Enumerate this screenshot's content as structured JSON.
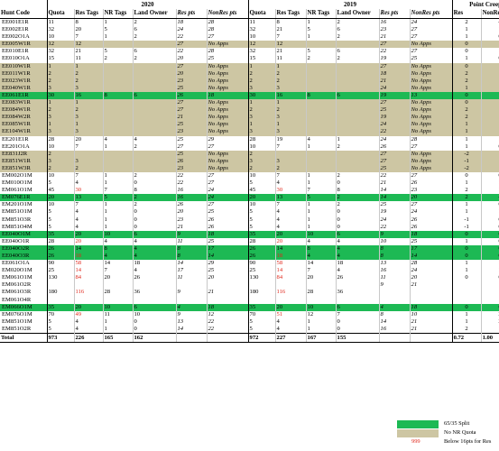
{
  "headers": {
    "year1": "2020",
    "year2": "2019",
    "creep": "Point Creep",
    "cols": [
      "Hunt Code",
      "Quota",
      "Res Tags",
      "NR Tags",
      "Land Owner",
      "Res pts",
      "NonRes pts",
      "Quota",
      "Res Tags",
      "NR Tags",
      "Land Owner",
      "Res pts",
      "NonRes pts",
      "Res",
      "NonRes"
    ]
  },
  "rows": [
    {
      "t": "w",
      "c": [
        "EE001E1R",
        "11",
        "8",
        "1",
        "2",
        "18",
        "28",
        "11",
        "8",
        "1",
        "2",
        "16",
        "24",
        "2",
        "4"
      ]
    },
    {
      "t": "w",
      "c": [
        "EE002E1R",
        "32",
        "20",
        "5",
        "6",
        "24",
        "28",
        "32",
        "21",
        "5",
        "6",
        "23",
        "27",
        "1",
        "1"
      ]
    },
    {
      "t": "w",
      "c": [
        "EE002O1A",
        "10",
        "7",
        "1",
        "2",
        "22",
        "27",
        "10",
        "7",
        "1",
        "2",
        "21",
        "27",
        "1",
        "0"
      ]
    },
    {
      "t": "tan",
      "c": [
        "EE005W1R",
        "12",
        "12",
        "",
        "",
        "27",
        "No Apps",
        "12",
        "12",
        "",
        "",
        "27",
        "No Apps",
        "0",
        ""
      ]
    },
    {
      "t": "w",
      "c": [
        "EE010E1R",
        "32",
        "21",
        "5",
        "6",
        "22",
        "28",
        "32",
        "21",
        "5",
        "6",
        "22",
        "27",
        "0",
        "1"
      ]
    },
    {
      "t": "w",
      "c": [
        "EE010O1A",
        "15",
        "11",
        "2",
        "2",
        "20",
        "25",
        "15",
        "11",
        "2",
        "2",
        "19",
        "25",
        "1",
        "0"
      ]
    },
    {
      "t": "tan",
      "c": [
        "EE010W1R",
        "1",
        "1",
        "",
        "",
        "27",
        "No Apps",
        "1",
        "1",
        "",
        "",
        "27",
        "No Apps",
        "0",
        ""
      ]
    },
    {
      "t": "tan",
      "c": [
        "EE011W1R",
        "2",
        "2",
        "",
        "",
        "20",
        "No Apps",
        "2",
        "2",
        "",
        "",
        "18",
        "No Apps",
        "2",
        ""
      ]
    },
    {
      "t": "tan",
      "c": [
        "EE023W1R",
        "2",
        "2",
        "",
        "",
        "23",
        "No Apps",
        "2",
        "2",
        "",
        "",
        "21",
        "No Apps",
        "2",
        ""
      ]
    },
    {
      "t": "tan",
      "c": [
        "EE040W1R",
        "3",
        "3",
        "",
        "",
        "25",
        "No Apps",
        "3",
        "3",
        "",
        "",
        "24",
        "No Apps",
        "1",
        ""
      ]
    },
    {
      "t": "green",
      "c": [
        "EE061E1R",
        "30",
        "16",
        "8",
        "6",
        "26",
        "18",
        "30",
        "16",
        "8",
        "6",
        "19",
        "13",
        "0",
        "1"
      ]
    },
    {
      "t": "tan",
      "c": [
        "EE083W1R",
        "1",
        "1",
        "",
        "",
        "27",
        "No Apps",
        "1",
        "1",
        "",
        "",
        "27",
        "No Apps",
        "0",
        ""
      ]
    },
    {
      "t": "tan",
      "c": [
        "EE084W1R",
        "2",
        "2",
        "",
        "",
        "27",
        "No Apps",
        "2",
        "2",
        "",
        "",
        "25",
        "No Apps",
        "2",
        ""
      ]
    },
    {
      "t": "tan",
      "c": [
        "EE084W2R",
        "3",
        "3",
        "",
        "",
        "21",
        "No Apps",
        "3",
        "3",
        "",
        "",
        "19",
        "No Apps",
        "2",
        ""
      ]
    },
    {
      "t": "tan",
      "c": [
        "EE085W1R",
        "1",
        "1",
        "",
        "",
        "25",
        "No Apps",
        "1",
        "1",
        "",
        "",
        "24",
        "No Apps",
        "1",
        ""
      ]
    },
    {
      "t": "tan",
      "c": [
        "EE104W1R",
        "3",
        "3",
        "",
        "",
        "23",
        "No Apps",
        "3",
        "3",
        "",
        "",
        "22",
        "No Apps",
        "1",
        ""
      ]
    },
    {
      "t": "w",
      "c": [
        "EE201E1R",
        "28",
        "20",
        "4",
        "4",
        "25",
        "29",
        "28",
        "19",
        "4",
        "1",
        "24",
        "28",
        "1",
        "1"
      ]
    },
    {
      "t": "w",
      "c": [
        "EE201O1A",
        "10",
        "7",
        "1",
        "2",
        "27",
        "27",
        "10",
        "7",
        "1",
        "2",
        "26",
        "27",
        "1",
        "0"
      ]
    },
    {
      "t": "tan",
      "c": [
        "EE831J2R",
        "2",
        "",
        "",
        "",
        "25",
        "No Apps",
        "2",
        "",
        "",
        "",
        "27",
        "No Apps",
        "-2",
        ""
      ]
    },
    {
      "t": "tan",
      "c": [
        "EE851W1R",
        "3",
        "3",
        "",
        "",
        "26",
        "No Apps",
        "3",
        "3",
        "",
        "",
        "27",
        "No Apps",
        "-1",
        ""
      ]
    },
    {
      "t": "tan",
      "c": [
        "EE851W3R",
        "2",
        "2",
        "",
        "",
        "23",
        "No Apps",
        "2",
        "2",
        "",
        "",
        "25",
        "No Apps",
        "-2",
        ""
      ]
    },
    {
      "t": "w",
      "c": [
        "EM002O1M",
        "10",
        "7",
        "1",
        "2",
        "22",
        "27",
        "10",
        "7",
        "1",
        "2",
        "22",
        "27",
        "0",
        "0"
      ]
    },
    {
      "t": "w",
      "c": [
        "EM010O1M",
        "5",
        "4",
        "1",
        "0",
        "22",
        "27",
        "5",
        "4",
        "1",
        "0",
        "21",
        "26",
        "1",
        "1"
      ]
    },
    {
      "t": "w",
      "c": [
        "EM061O1M",
        "45",
        "30",
        "7",
        "8",
        "16",
        "24",
        "45",
        "30",
        "7",
        "8",
        "14",
        "23",
        "2",
        "1"
      ]
    },
    {
      "t": "green",
      "c": [
        "EM076E1R",
        "20",
        "13",
        "5",
        "2",
        "16",
        "24",
        "20",
        "13",
        "5",
        "2",
        "14",
        "20",
        "2",
        "4"
      ]
    },
    {
      "t": "w",
      "c": [
        "EM201O1M",
        "10",
        "7",
        "1",
        "2",
        "26",
        "27",
        "10",
        "7",
        "1",
        "2",
        "25",
        "27",
        "1",
        "0"
      ]
    },
    {
      "t": "w",
      "c": [
        "EM851O1M",
        "5",
        "4",
        "1",
        "0",
        "20",
        "25",
        "5",
        "4",
        "1",
        "0",
        "19",
        "24",
        "1",
        "1"
      ]
    },
    {
      "t": "w",
      "c": [
        "EM851O3R",
        "5",
        "4",
        "1",
        "0",
        "23",
        "26",
        "5",
        "4",
        "1",
        "0",
        "24",
        "26",
        "-1",
        "0"
      ]
    },
    {
      "t": "w",
      "c": [
        "EM851O4M",
        "5",
        "4",
        "1",
        "0",
        "21",
        "26",
        "5",
        "4",
        "1",
        "0",
        "22",
        "26",
        "-1",
        "0"
      ]
    },
    {
      "t": "green",
      "c": [
        "EE040O1M",
        "35",
        "20",
        "10",
        "6",
        "9",
        "18",
        "35",
        "20",
        "10",
        "6",
        "9",
        "18",
        "0",
        "0"
      ]
    },
    {
      "t": "w",
      "c": [
        "EE040O1R",
        "28",
        "20",
        "4",
        "4",
        "11",
        "25",
        "28",
        "20",
        "4",
        "4",
        "10",
        "25",
        "1",
        "0"
      ]
    },
    {
      "t": "green",
      "c": [
        "EE040O2R",
        "26",
        "14",
        "8",
        "4",
        "8",
        "17",
        "26",
        "14",
        "8",
        "4",
        "8",
        "17",
        "0",
        "0"
      ]
    },
    {
      "t": "green",
      "c": [
        "EE040O3R",
        "26",
        "18",
        "4",
        "4",
        "8",
        "14",
        "26",
        "18",
        "4",
        "4",
        "8",
        "14",
        "0",
        "0"
      ]
    },
    {
      "t": "w",
      "c": [
        "EE061O1A",
        "90",
        "58",
        "14",
        "18",
        "14",
        "29",
        "90",
        "58",
        "14",
        "18",
        "13",
        "28",
        "1",
        "1"
      ]
    },
    {
      "t": "w",
      "c": [
        "EM020O1M",
        "25",
        "14",
        "7",
        "4",
        "17",
        "25",
        "25",
        "14",
        "7",
        "4",
        "16",
        "24",
        "1",
        "1"
      ]
    },
    {
      "t": "w",
      "c": [
        "EM061O1M",
        "130",
        "84",
        "20",
        "26",
        "11",
        "20",
        "130",
        "84",
        "20",
        "26",
        "11",
        "20",
        "0",
        "0"
      ]
    },
    {
      "t": "w",
      "c": [
        "EM061O2R",
        "",
        "",
        "",
        "",
        "",
        "",
        "",
        "",
        "",
        "",
        "9",
        "21",
        "",
        ""
      ]
    },
    {
      "t": "w",
      "c": [
        "EM061O3R",
        "180",
        "116",
        "28",
        "36",
        "9",
        "21",
        "180",
        "116",
        "28",
        "36",
        "",
        "",
        "",
        ""
      ]
    },
    {
      "t": "w",
      "c": [
        "EM061O4R",
        "",
        "",
        "",
        "",
        "",
        "",
        "",
        "",
        "",
        "",
        "",
        "",
        "",
        ""
      ]
    },
    {
      "t": "green",
      "c": [
        "EM066O1M",
        "35",
        "20",
        "10",
        "6",
        "4",
        "18",
        "35",
        "20",
        "10",
        "6",
        "4",
        "18",
        "0",
        "0"
      ]
    },
    {
      "t": "w",
      "c": [
        "EM076O1M",
        "70",
        "49",
        "11",
        "10",
        "9",
        "12",
        "70",
        "51",
        "12",
        "7",
        "8",
        "10",
        "1",
        "2"
      ]
    },
    {
      "t": "w",
      "c": [
        "EM851O1M",
        "5",
        "4",
        "1",
        "0",
        "13",
        "22",
        "5",
        "4",
        "1",
        "0",
        "14",
        "21",
        "1",
        "2"
      ]
    },
    {
      "t": "w",
      "c": [
        "EM851O2R",
        "5",
        "4",
        "1",
        "0",
        "14",
        "22",
        "5",
        "4",
        "1",
        "0",
        "16",
        "21",
        "2",
        "1"
      ]
    }
  ],
  "total": [
    "Total",
    "973",
    "226",
    "165",
    "162",
    "",
    "",
    "972",
    "227",
    "167",
    "155",
    "",
    "",
    "0.72",
    "1.00"
  ],
  "legend": {
    "green_label": "65/35 Split",
    "tan_label": "No NR Quota",
    "red_sample": "999",
    "red_label": "Below 16pts for Res"
  },
  "colors": {
    "green": "#1db954",
    "tan": "#cdc6a3",
    "red": "#e0281c"
  }
}
